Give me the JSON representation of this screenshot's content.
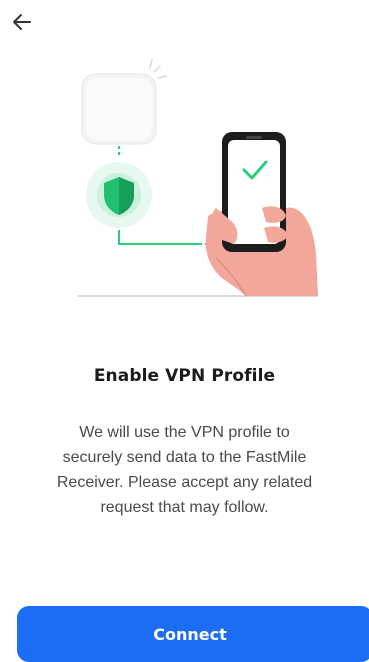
{
  "icons": {
    "back": "arrow-left-icon",
    "router": "router-device-icon",
    "shield": "shield-icon",
    "phone": "smartphone-icon",
    "check": "checkmark-icon"
  },
  "colors": {
    "accent": "#1b6ef3",
    "green": "#2bcc7a",
    "hand": "#f3a69a"
  },
  "content": {
    "title": "Enable VPN Profile",
    "description": "We will use the VPN profile to\nsecurely send data to the FastMile\nReceiver. Please accept any related\nrequest that may follow."
  },
  "actions": {
    "connect_label": "Connect"
  }
}
